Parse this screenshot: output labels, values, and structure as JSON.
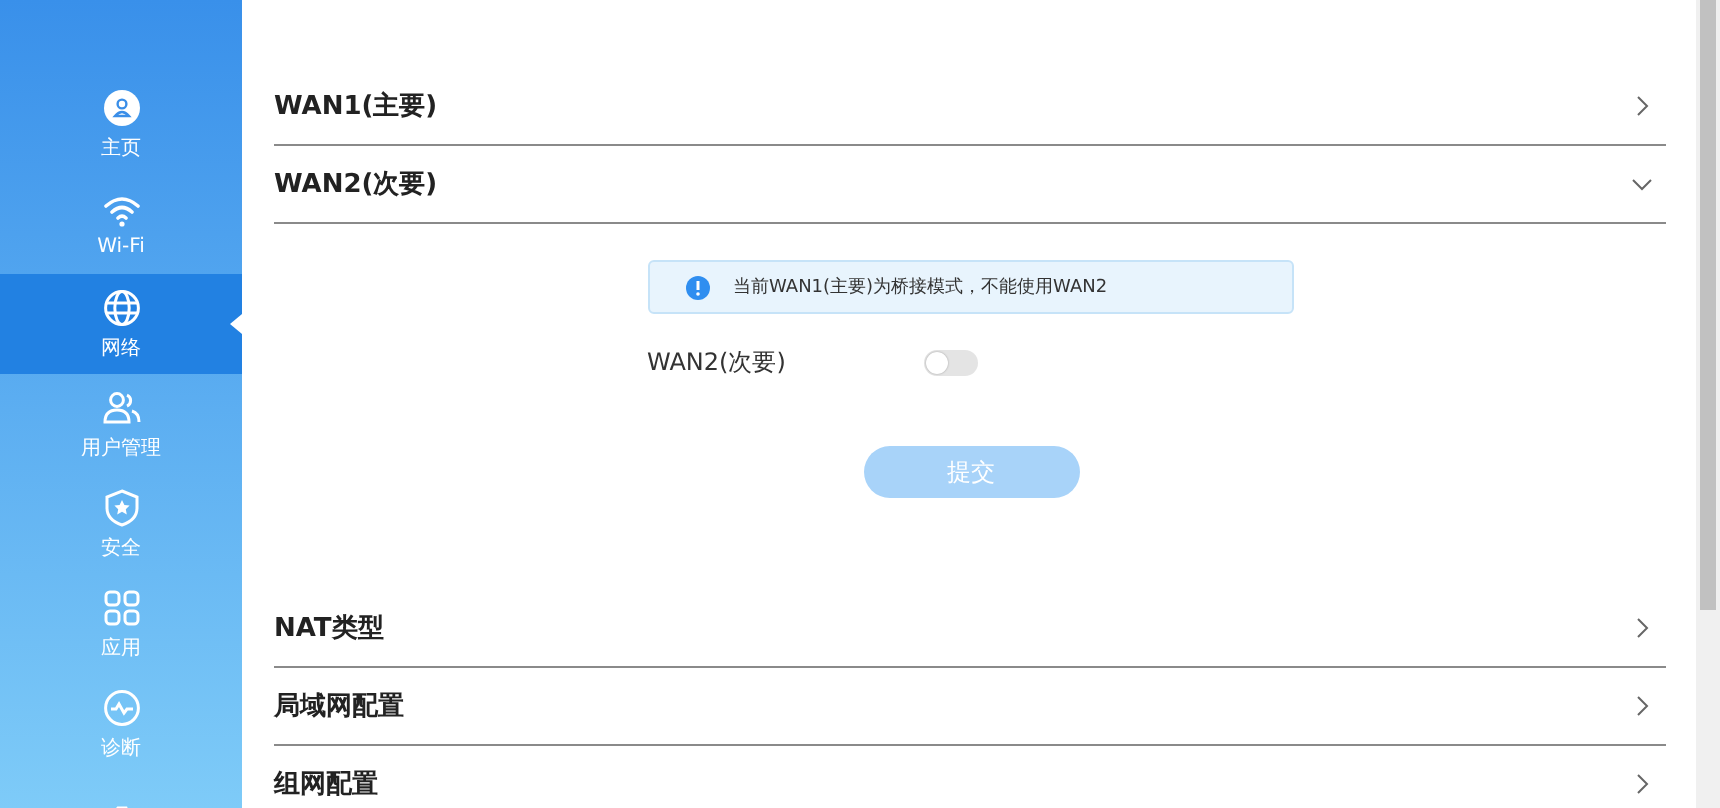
{
  "sidebar": {
    "items": [
      {
        "label": "主页",
        "selected": false
      },
      {
        "label": "Wi-Fi",
        "selected": false
      },
      {
        "label": "网络",
        "selected": true
      },
      {
        "label": "用户管理",
        "selected": false
      },
      {
        "label": "安全",
        "selected": false
      },
      {
        "label": "应用",
        "selected": false
      },
      {
        "label": "诊断",
        "selected": false
      },
      {
        "selected": false
      }
    ]
  },
  "sections": [
    {
      "title": "WAN1(主要)",
      "expanded": false
    },
    {
      "title": "WAN2(次要)",
      "expanded": true,
      "alert": "当前WAN1(主要)为桥接模式，不能使用WAN2",
      "toggle": {
        "label": "WAN2(次要)",
        "on": false
      },
      "submit": {
        "label": "提交",
        "disabled": true
      }
    },
    {
      "title": "NAT类型",
      "expanded": false
    },
    {
      "title": "局域网配置",
      "expanded": false
    },
    {
      "title": "组网配置",
      "expanded": false
    }
  ]
}
